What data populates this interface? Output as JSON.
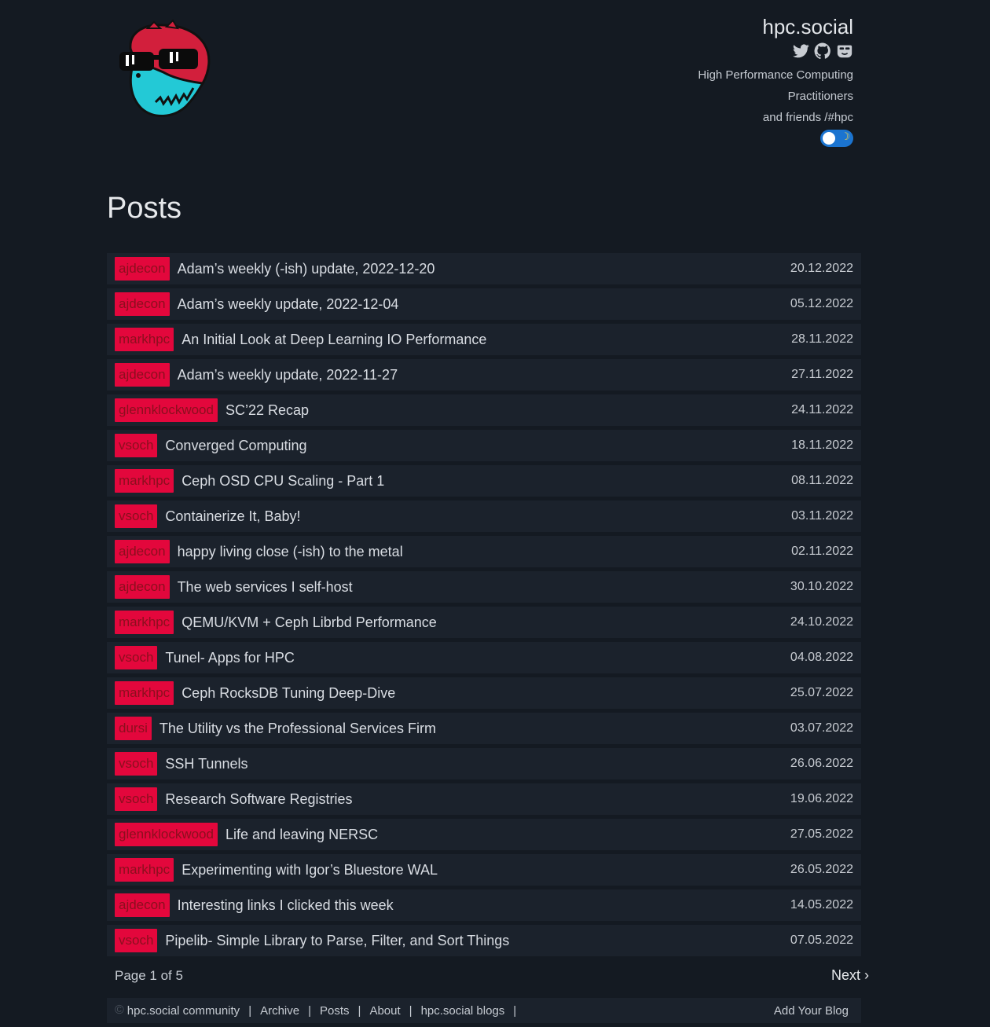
{
  "header": {
    "site_title": "hpc.social",
    "tagline": [
      "High Performance Computing",
      "Practitioners",
      "and friends /#hpc"
    ],
    "social_icons": [
      "twitter-icon",
      "github-icon",
      "mastodon-icon"
    ],
    "theme_toggle": {
      "state": "dark",
      "icon": "moon-icon"
    }
  },
  "main": {
    "title": "Posts",
    "posts": [
      {
        "author": "ajdecon",
        "title": "Adam’s weekly (-ish) update, 2022-12-20",
        "date": "20.12.2022"
      },
      {
        "author": "ajdecon",
        "title": "Adam’s weekly update, 2022-12-04",
        "date": "05.12.2022"
      },
      {
        "author": "markhpc",
        "title": "An Initial Look at Deep Learning IO Performance",
        "date": "28.11.2022"
      },
      {
        "author": "ajdecon",
        "title": "Adam’s weekly update, 2022-11-27",
        "date": "27.11.2022"
      },
      {
        "author": "glennklockwood",
        "title": "SC’22 Recap",
        "date": "24.11.2022"
      },
      {
        "author": "vsoch",
        "title": "Converged Computing",
        "date": "18.11.2022"
      },
      {
        "author": "markhpc",
        "title": "Ceph OSD CPU Scaling - Part 1",
        "date": "08.11.2022"
      },
      {
        "author": "vsoch",
        "title": "Containerize It, Baby!",
        "date": "03.11.2022"
      },
      {
        "author": "ajdecon",
        "title": "happy living close (-ish) to the metal",
        "date": "02.11.2022"
      },
      {
        "author": "ajdecon",
        "title": "The web services I self-host",
        "date": "30.10.2022"
      },
      {
        "author": "markhpc",
        "title": "QEMU/KVM + Ceph Librbd Performance",
        "date": "24.10.2022"
      },
      {
        "author": "vsoch",
        "title": "Tunel- Apps for HPC",
        "date": "04.08.2022"
      },
      {
        "author": "markhpc",
        "title": "Ceph RocksDB Tuning Deep-Dive",
        "date": "25.07.2022"
      },
      {
        "author": "dursi",
        "title": "The Utility vs the Professional Services Firm",
        "date": "03.07.2022"
      },
      {
        "author": "vsoch",
        "title": "SSH Tunnels",
        "date": "26.06.2022"
      },
      {
        "author": "vsoch",
        "title": "Research Software Registries",
        "date": "19.06.2022"
      },
      {
        "author": "glennklockwood",
        "title": "Life and leaving NERSC",
        "date": "27.05.2022"
      },
      {
        "author": "markhpc",
        "title": "Experimenting with Igor’s Bluestore WAL",
        "date": "26.05.2022"
      },
      {
        "author": "ajdecon",
        "title": "Interesting links I clicked this week",
        "date": "14.05.2022"
      },
      {
        "author": "vsoch",
        "title": "Pipelib- Simple Library to Parse, Filter, and Sort Things",
        "date": "07.05.2022"
      }
    ]
  },
  "pagination": {
    "label": "Page 1 of 5",
    "next": "Next ›"
  },
  "footer": {
    "copyright_symbol": "©",
    "links": [
      "hpc.social community",
      "Archive",
      "Posts",
      "About",
      "hpc.social blogs"
    ],
    "add_blog": "Add Your Blog"
  },
  "colors": {
    "background": "#141a22",
    "row": "#1b222c",
    "author_badge": "#e3073c",
    "toggle": "#1b74d0"
  }
}
